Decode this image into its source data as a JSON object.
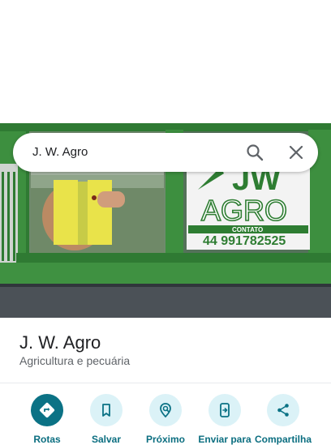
{
  "search": {
    "query": "J. W. Agro"
  },
  "photo": {
    "sign": {
      "letters_top": "JW",
      "brand": "AGRO",
      "contact_label": "CONTATO",
      "phone": "44 991782525"
    }
  },
  "place": {
    "name": "J. W. Agro",
    "category": "Agricultura e pecuária"
  },
  "actions": [
    {
      "label": "Rotas",
      "icon": "directions-icon"
    },
    {
      "label": "Salvar",
      "icon": "bookmark-icon"
    },
    {
      "label": "Próximo",
      "icon": "nearby-icon"
    },
    {
      "label": "Enviar para",
      "icon": "send-to-phone-icon"
    },
    {
      "label": "Compartilha",
      "icon": "share-icon"
    }
  ],
  "colors": {
    "accent": "#0b7285",
    "action_bg": "#dbf2f7",
    "storefront_green": "#3a8a3a"
  }
}
